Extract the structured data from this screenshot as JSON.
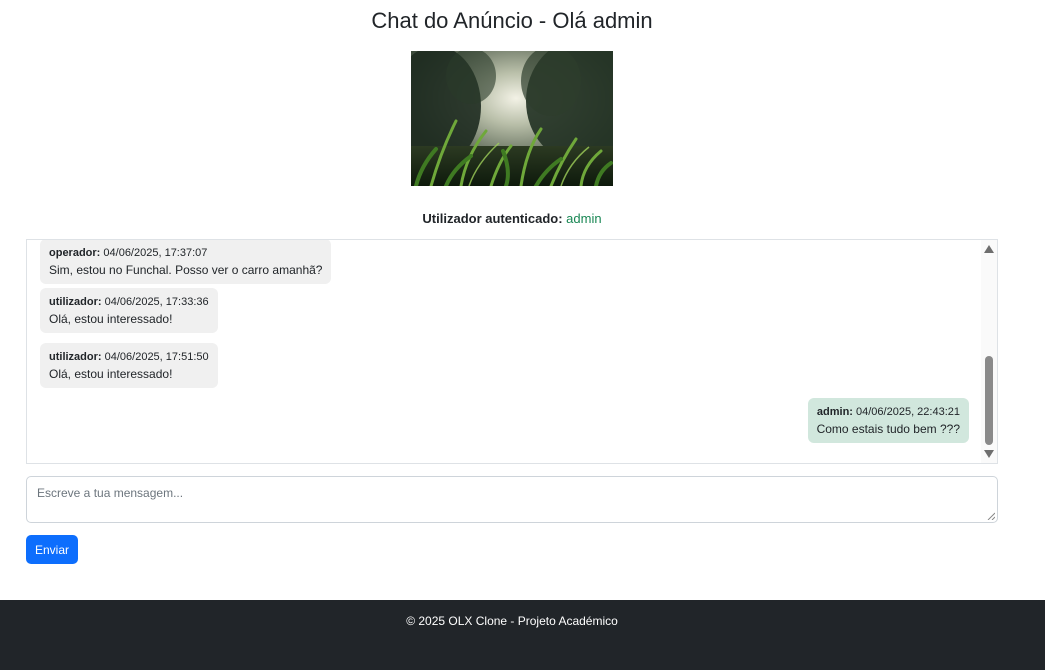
{
  "page": {
    "title": "Chat do Anúncio - Olá admin"
  },
  "ad": {
    "image_alt": "Ad image showing grass close-up against trees and sky"
  },
  "auth": {
    "label": "Utilizador autenticado:",
    "username": "admin"
  },
  "messages": [
    {
      "author": "operador:",
      "timestamp": "04/06/2025, 17:37:07",
      "text": "Sim, estou no Funchal. Posso ver o carro amanhã?",
      "side": "other"
    },
    {
      "author": "utilizador:",
      "timestamp": "04/06/2025, 17:33:36",
      "text": "Olá, estou interessado!",
      "side": "other"
    },
    {
      "author": "utilizador:",
      "timestamp": "04/06/2025, 17:51:50",
      "text": "Olá, estou interessado!",
      "side": "other"
    },
    {
      "author": "admin:",
      "timestamp": "04/06/2025, 22:43:21",
      "text": "Como estais tudo bem ???",
      "side": "mine"
    }
  ],
  "composer": {
    "placeholder": "Escreve a tua mensagem...",
    "value": "",
    "send_label": "Enviar"
  },
  "footer": {
    "text": "© 2025 OLX Clone - Projeto Académico"
  },
  "colors": {
    "primary": "#0d6efd",
    "success": "#198754",
    "own_bubble": "#d1e7dd",
    "other_bubble": "#f0f0f0",
    "footer_bg": "#212529"
  }
}
